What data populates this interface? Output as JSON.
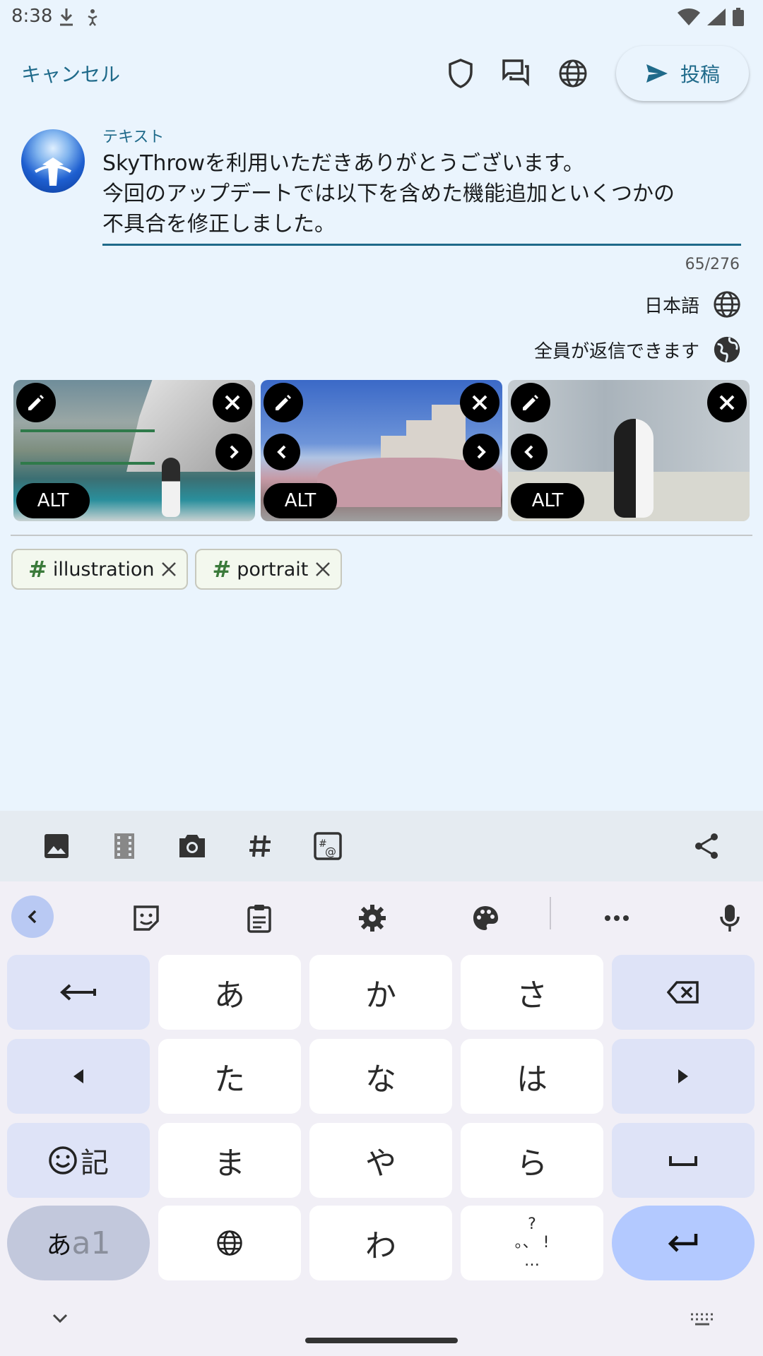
{
  "status_bar": {
    "time": "8:38"
  },
  "top_bar": {
    "cancel_label": "キャンセル",
    "post_label": "投稿"
  },
  "compose": {
    "field_label": "テキスト",
    "text": "SkyThrowを利用いただきありがとうございます。\n今回のアップデートでは以下を含めた機能追加といくつかの\n不具合を修正しました。",
    "counter": "65/276",
    "language": "日本語",
    "reply_setting": "全員が返信できます"
  },
  "media": [
    {
      "alt_label": "ALT"
    },
    {
      "alt_label": "ALT"
    },
    {
      "alt_label": "ALT"
    }
  ],
  "tags": [
    {
      "hash": "#",
      "label": "illustration"
    },
    {
      "hash": "#",
      "label": "portrait"
    }
  ],
  "keyboard": {
    "rows": [
      [
        "←",
        "あ",
        "か",
        "さ",
        "⌫"
      ],
      [
        "◀",
        "た",
        "な",
        "は",
        "▶"
      ],
      [
        "☺記",
        "ま",
        "や",
        "ら",
        "␣"
      ],
      [
        "あa1",
        "🌐",
        "わ",
        "、。?!",
        "↵"
      ]
    ],
    "key_a": "あ",
    "key_ka": "か",
    "key_sa": "さ",
    "key_ta": "た",
    "key_na": "な",
    "key_ha": "は",
    "key_ma": "ま",
    "key_ya": "や",
    "key_ra": "ら",
    "key_wa": "わ",
    "key_kigou": "記",
    "key_mode_main": "あ",
    "key_mode_sub": "a1",
    "punct_top": "?",
    "punct_mid": "。、 !",
    "punct_bot": "…"
  },
  "colors": {
    "accent": "#1f6a8a",
    "background": "#eaf4fd",
    "tag_hash": "#3a7a3a",
    "enter_key": "#b3c9ff"
  }
}
